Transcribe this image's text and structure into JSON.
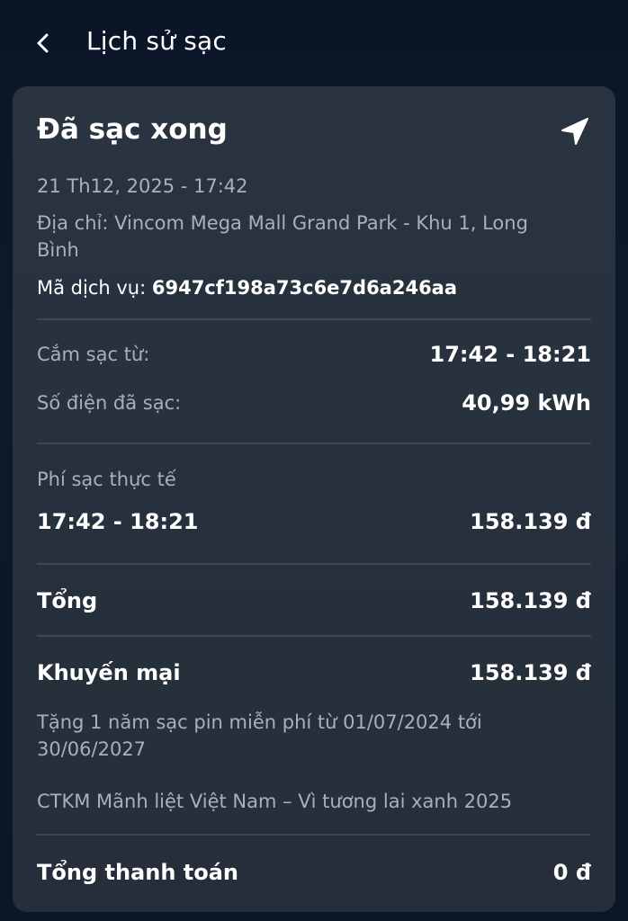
{
  "header": {
    "back_icon": "chevron-left-icon",
    "title": "Lịch sử sạc"
  },
  "card": {
    "status": "Đã sạc xong",
    "nav_icon": "navigation-arrow-icon",
    "datetime": "21 Th12, 2025 - 17:42",
    "address_line1": "Địa chỉ: Vincom Mega Mall Grand Park - Khu 1, Long",
    "address_line2": "Bình",
    "service_code_label": "Mã dịch vụ:",
    "service_code_value": "6947cf198a73c6e7d6a246aa",
    "plug_label": "Cắm sạc từ:",
    "plug_value": "17:42 - 18:21",
    "energy_label": "Số điện đã sạc:",
    "energy_value": "40,99 kWh",
    "actual_fee_label": "Phí sạc thực tế",
    "fee_time": "17:42 - 18:21",
    "fee_amount": "158.139 đ",
    "total_label": "Tổng",
    "total_value": "158.139 đ",
    "promo_label": "Khuyến mại",
    "promo_value": "158.139 đ",
    "promo_desc_line1": "Tặng 1 năm sạc pin miễn phí từ 01/07/2024 tới",
    "promo_desc_line2": "30/06/2027",
    "campaign": "CTKM Mãnh liệt Việt Nam – Vì tương lai xanh 2025",
    "grand_total_label": "Tổng thanh toán",
    "grand_total_value": "0 đ"
  }
}
